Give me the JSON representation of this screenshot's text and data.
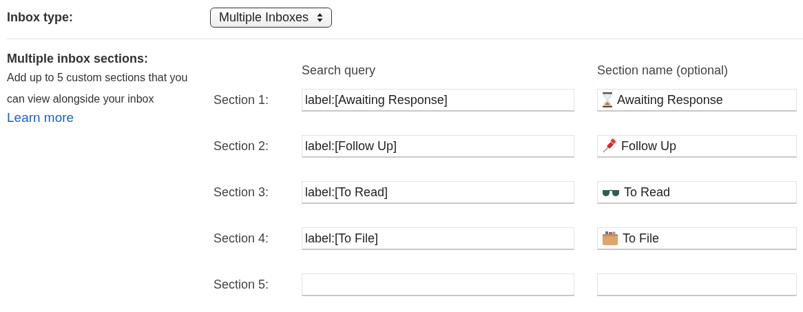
{
  "inbox_type": {
    "label": "Inbox type:",
    "value": "Multiple Inboxes"
  },
  "sections_setting": {
    "title": "Multiple inbox sections:",
    "description": "Add up to 5 custom sections that you can view alongside your inbox",
    "link": "Learn more"
  },
  "columns": [
    "Search query",
    "Section name (optional)"
  ],
  "sections": [
    {
      "label": "Section 1:",
      "query": "label:[Awaiting Response]",
      "name": {
        "kind": "hourglass",
        "text": "Awaiting Response"
      }
    },
    {
      "label": "Section 2:",
      "query": "label:[Follow Up]",
      "name": {
        "kind": "pushpin",
        "text": "Follow Up"
      }
    },
    {
      "label": "Section 3:",
      "query": "label:[To Read]",
      "name": {
        "kind": "glasses",
        "text": "To Read"
      }
    },
    {
      "label": "Section 4:",
      "query": "label:[To File]",
      "name": {
        "kind": "cardbox",
        "text": "To File"
      }
    },
    {
      "label": "Section 5:"
    }
  ]
}
